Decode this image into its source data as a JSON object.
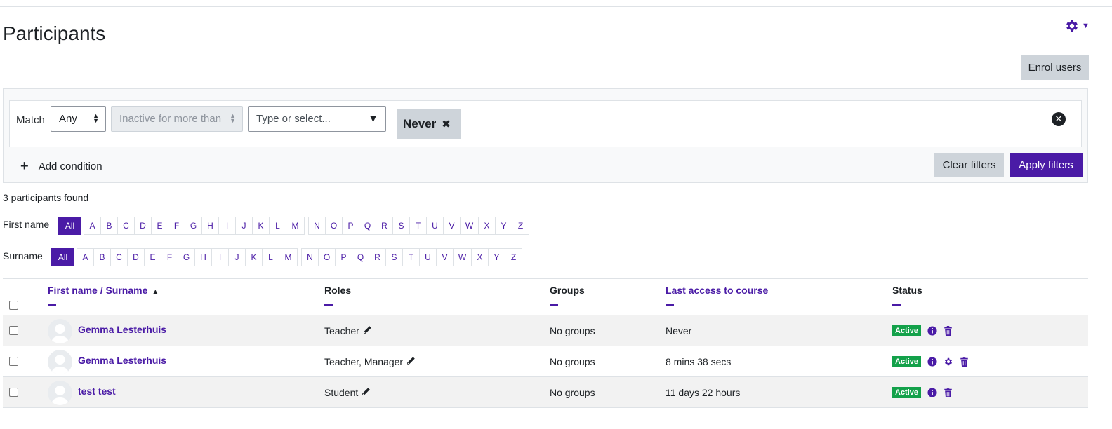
{
  "page": {
    "title": "Participants",
    "enrol_label": "Enrol users"
  },
  "filters": {
    "match_label": "Match",
    "match_value": "Any",
    "condition_type": "Inactive for more than",
    "value_placeholder": "Type or select...",
    "selected_chip": "Never",
    "add_condition": "Add condition",
    "clear_label": "Clear filters",
    "apply_label": "Apply filters"
  },
  "results": {
    "found_text": "3 participants found"
  },
  "initials": {
    "firstname_label": "First name",
    "surname_label": "Surname",
    "all_label": "All",
    "letters": [
      "A",
      "B",
      "C",
      "D",
      "E",
      "F",
      "G",
      "H",
      "I",
      "J",
      "K",
      "L",
      "M",
      "N",
      "O",
      "P",
      "Q",
      "R",
      "S",
      "T",
      "U",
      "V",
      "W",
      "X",
      "Y",
      "Z"
    ]
  },
  "table": {
    "headers": {
      "name": "First name / Surname",
      "roles": "Roles",
      "groups": "Groups",
      "last_access": "Last access to course",
      "status": "Status"
    },
    "rows": [
      {
        "name": "Gemma Lesterhuis",
        "roles": "Teacher",
        "groups": "No groups",
        "last_access": "Never",
        "status": "Active"
      },
      {
        "name": "Gemma Lesterhuis",
        "roles": "Teacher, Manager",
        "groups": "No groups",
        "last_access": "8 mins 38 secs",
        "status": "Active"
      },
      {
        "name": "test test",
        "roles": "Student",
        "groups": "No groups",
        "last_access": "11 days 22 hours",
        "status": "Active"
      }
    ]
  },
  "colors": {
    "brand": "#4a1ba6",
    "active_badge": "#13a14a",
    "secondary_button": "#ced4da"
  }
}
